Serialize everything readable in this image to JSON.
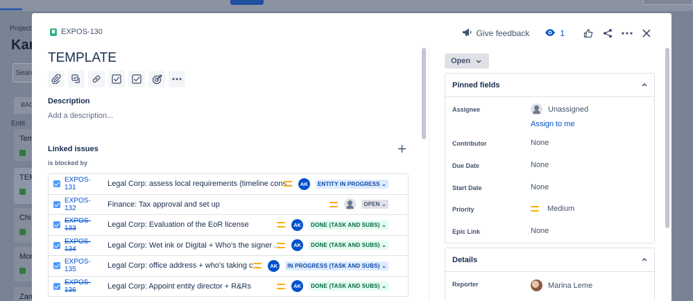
{
  "background": {
    "breadcrumb_fragment": "Project",
    "board_title_fragment": "Kan",
    "search_fragment": "Searc",
    "column_fragment": "BAC",
    "group_fragment": "Entit",
    "cards": [
      "Tem",
      "TEM",
      "Chi",
      "Mon",
      "Zam"
    ]
  },
  "issue": {
    "key": "EXPOS-130",
    "title": "TEMPLATE"
  },
  "top_actions": {
    "feedback_label": "Give feedback",
    "watch_count": "1"
  },
  "toolbar": {
    "icons": [
      "paperclip-icon",
      "subtask-icon",
      "link-icon",
      "checkbox-icon",
      "checkbox-icon",
      "target-icon",
      "more-icon"
    ]
  },
  "description": {
    "heading": "Description",
    "placeholder": "Add a description..."
  },
  "linked": {
    "heading": "Linked issues",
    "relation": "is blocked by",
    "items": [
      {
        "key": "EXPOS-131",
        "summary": "Legal Corp: assess local requirements (timeline cons...",
        "done": false,
        "assignee": "AK",
        "status": "ENTITY IN PROGRESS",
        "status_color": "blue"
      },
      {
        "key": "EXPOS-132",
        "summary": "Finance: Tax approval and set up",
        "done": false,
        "assignee": "",
        "status": "OPEN",
        "status_color": "grey"
      },
      {
        "key": "EXPOS-133",
        "summary": "Legal Corp: Evaluation of the EoR license",
        "done": true,
        "assignee": "AK",
        "status": "DONE (TASK AND SUBS)",
        "status_color": "green"
      },
      {
        "key": "EXPOS-134",
        "summary": "Legal Corp: Wet ink or Digital + Who's the signer ...",
        "done": true,
        "assignee": "AK",
        "status": "DONE (TASK AND SUBS)",
        "status_color": "green"
      },
      {
        "key": "EXPOS-135",
        "summary": "Legal Corp: office address + who's taking c...",
        "done": false,
        "assignee": "AK",
        "status": "IN PROGRESS (TASK AND SUBS)",
        "status_color": "blue"
      },
      {
        "key": "EXPOS-136",
        "summary": "Legal Corp: Appoint entity director + R&Rs",
        "done": true,
        "assignee": "AK",
        "status": "DONE (TASK AND SUBS)",
        "status_color": "green"
      }
    ]
  },
  "status_button": "Open",
  "pinned": {
    "heading": "Pinned fields",
    "assignee_label": "Assignee",
    "assignee_value": "Unassigned",
    "assign_to_me": "Assign to me",
    "contributor_label": "Contributor",
    "contributor_value": "None",
    "due_label": "Due Date",
    "due_value": "None",
    "start_label": "Start Date",
    "start_value": "None",
    "priority_label": "Priority",
    "priority_value": "Medium",
    "epic_label": "Epic Link",
    "epic_value": "None"
  },
  "details": {
    "heading": "Details",
    "reporter_label": "Reporter",
    "reporter_value": "Marina Leme"
  },
  "colors": {
    "link": "#0052cc",
    "medium_priority": "#ffab00",
    "avatar": "#0052cc"
  }
}
